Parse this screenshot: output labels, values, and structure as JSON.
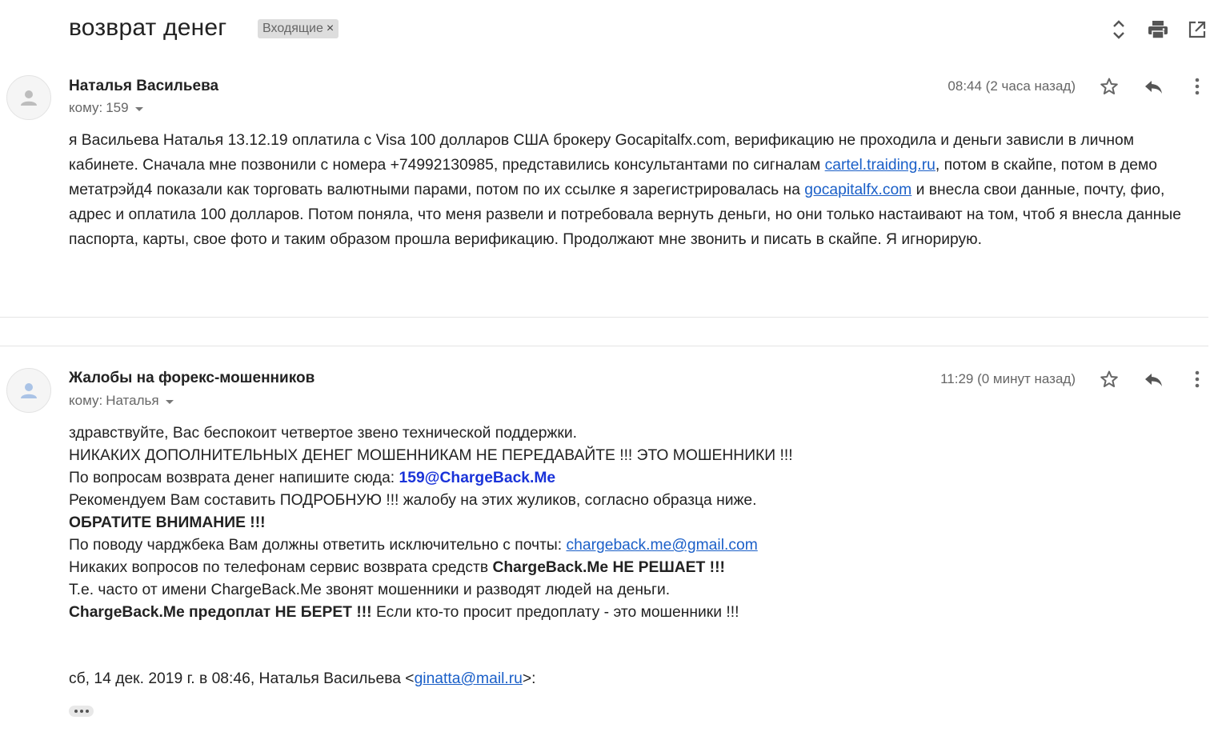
{
  "subject": "возврат денег",
  "label": {
    "name": "Входящие",
    "remove": "×"
  },
  "messages": [
    {
      "sender": "Наталья Васильева",
      "to_prefix": "кому:",
      "to": "159",
      "time": "08:44 (2 часа назад)",
      "body": {
        "p1": "я Васильева Наталья 13.12.19 оплатила с Visa 100 долларов США брокеру Gocapitalfx.com, верификацию не проходила и деньги зависли в личном кабинете. Сначала мне позвонили с номера +74992130985, представились консультантами по сигналам ",
        "link1": "cartel.traiding.ru",
        "p2": ", потом в скайпе, потом в демо метатрэйд4 показали как торговать валютными парами, потом по их ссылке я зарегистрировалась на ",
        "link2": "gocapitalfx.com",
        "p3": " и внесла свои данные, почту, фио, адрес и оплатила 100 долларов. Потом поняла, что меня развели и потребовала вернуть деньги, но они только настаивают на том, чтоб я внесла данные паспорта, карты, свое фото и таким образом прошла верификацию. Продолжают мне звонить и писать в скайпе. Я игнорирую."
      }
    },
    {
      "sender": "Жалобы на форекс-мошенников",
      "to_prefix": "кому:",
      "to": "Наталья",
      "time": "11:29 (0 минут назад)",
      "lines": {
        "l1": "здравствуйте, Вас беспокоит четвертое звено технической поддержки.",
        "l2": "НИКАКИХ ДОПОЛНИТЕЛЬНЫХ ДЕНЕГ МОШЕННИКАМ НЕ ПЕРЕДАВАЙТЕ !!! ЭТО МОШЕННИКИ !!!",
        "l3_text": "По вопросам возврата денег напишите сюда: ",
        "l3_email": "159@ChargeBack.Me",
        "l4": "Рекомендуем Вам составить ПОДРОБНУЮ !!! жалобу на этих жуликов, согласно образца ниже.",
        "l5": "ОБРАТИТЕ ВНИМАНИЕ !!!",
        "l6_text": "По поводу чарджбека Вам должны ответить исключительно с почты: ",
        "l6_email": "chargeback.me@gmail.com",
        "l7_text": "Никаких вопросов по телефонам сервис возврата средств ",
        "l7_bold": "ChargeBack.Me НЕ РЕШАЕТ !!!",
        "l8": "Т.е. часто от имени ChargeBack.Me звонят мошенники и разводят людей на деньги.",
        "l9_bold": "ChargeBack.Me предоплат НЕ БЕРЕТ !!!",
        "l9_text": " Если кто-то просит предоплату - это мошенники !!!"
      },
      "quote": {
        "prefix": "сб, 14 дек. 2019 г. в 08:46, Наталья Васильева <",
        "email": "ginatta@mail.ru",
        "suffix": ">:"
      }
    }
  ],
  "icons": {
    "expand": "expand-collapse-icon",
    "print": "print-icon",
    "open_new": "open-in-new-window-icon",
    "star": "star-icon",
    "reply": "reply-icon",
    "more": "more-vertical-icon",
    "avatar": "person-icon",
    "show_trimmed": "ellipsis-icon"
  },
  "colors": {
    "link": "#1a5fc8",
    "email_highlight": "#1a33d9",
    "label_bg": "#dddddd"
  }
}
